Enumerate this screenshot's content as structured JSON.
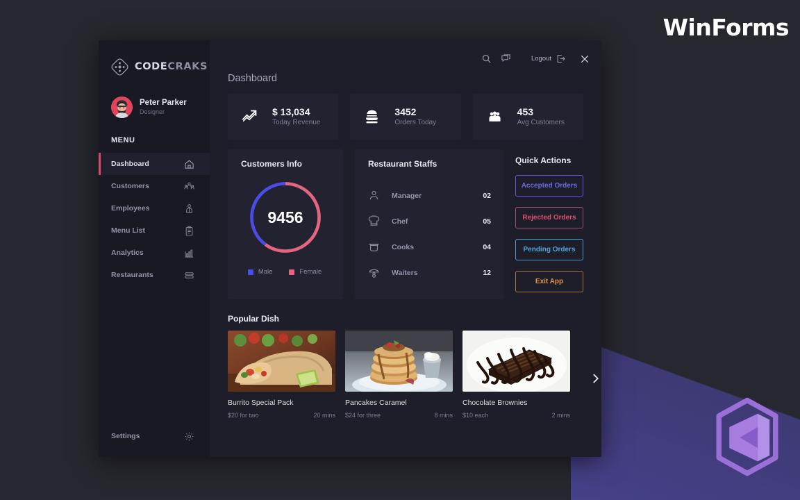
{
  "watermark": {
    "winforms": "WinForms",
    "vs_logo": "visual-studio-logo"
  },
  "brand": {
    "part1": "CODE",
    "part2": "CRAKS",
    "icon": "diamond-logo-icon"
  },
  "profile": {
    "name": "Peter Parker",
    "role": "Designer",
    "avatar": "user-avatar"
  },
  "sidebar": {
    "menu_label": "MENU",
    "items": [
      {
        "label": "Dashboard",
        "icon": "home-icon",
        "active": true
      },
      {
        "label": "Customers",
        "icon": "customers-icon",
        "active": false
      },
      {
        "label": "Employees",
        "icon": "employee-icon",
        "active": false
      },
      {
        "label": "Menu List",
        "icon": "clipboard-icon",
        "active": false
      },
      {
        "label": "Analytics",
        "icon": "bar-chart-icon",
        "active": false
      },
      {
        "label": "Restaurants",
        "icon": "restaurant-icon",
        "active": false
      }
    ],
    "settings": {
      "label": "Settings",
      "icon": "gear-icon"
    }
  },
  "topbar": {
    "search_icon": "search-icon",
    "message_icon": "chat-icon",
    "logout_label": "Logout",
    "logout_icon": "logout-icon",
    "close_icon": "close-icon"
  },
  "page": {
    "title": "Dashboard"
  },
  "stats": [
    {
      "value": "$ 13,034",
      "label": "Today Revenue",
      "icon": "trend-up-icon"
    },
    {
      "value": "3452",
      "label": "Orders Today",
      "icon": "burger-icon"
    },
    {
      "value": "453",
      "label": "Avg Customers",
      "icon": "people-group-icon"
    }
  ],
  "customers_info": {
    "title": "Customers Info",
    "total": "9456",
    "legend": [
      {
        "label": "Male",
        "color": "#4b4be6"
      },
      {
        "label": "Female",
        "color": "#e4657f"
      }
    ]
  },
  "staffs": {
    "title": "Restaurant Staffs",
    "rows": [
      {
        "role": "Manager",
        "count": "02",
        "icon": "person-icon"
      },
      {
        "role": "Chef",
        "count": "05",
        "icon": "chef-hat-icon"
      },
      {
        "role": "Cooks",
        "count": "04",
        "icon": "cooking-pot-icon"
      },
      {
        "role": "Waiters",
        "count": "12",
        "icon": "waiter-icon"
      }
    ]
  },
  "quick_actions": {
    "title": "Quick Actions",
    "buttons": [
      {
        "label": "Accepted Orders",
        "color": "#6159e0"
      },
      {
        "label": "Rejected Orders",
        "color": "#e0506d"
      },
      {
        "label": "Pending Orders",
        "color": "#4a9fd4"
      },
      {
        "label": "Exit App",
        "color": "#e0944a"
      }
    ]
  },
  "popular_dish": {
    "title": "Popular Dish",
    "next_icon": "chevron-right-icon",
    "items": [
      {
        "name": "Burrito Special Pack",
        "price": "$20 for two",
        "time": "20 mins",
        "image": "burrito-photo"
      },
      {
        "name": "Pancakes Caramel",
        "price": "$24 for three",
        "time": "8 mins",
        "image": "pancakes-photo"
      },
      {
        "name": "Chocolate Brownies",
        "price": "$10 each",
        "time": "2 mins",
        "image": "brownie-photo"
      }
    ]
  },
  "chart_data": {
    "type": "pie",
    "title": "Customers Info",
    "categories": [
      "Male",
      "Female"
    ],
    "values": [
      40,
      60
    ],
    "center_label": "9456",
    "colors": [
      "#4b4be6",
      "#e4657f"
    ],
    "legend_position": "bottom"
  }
}
